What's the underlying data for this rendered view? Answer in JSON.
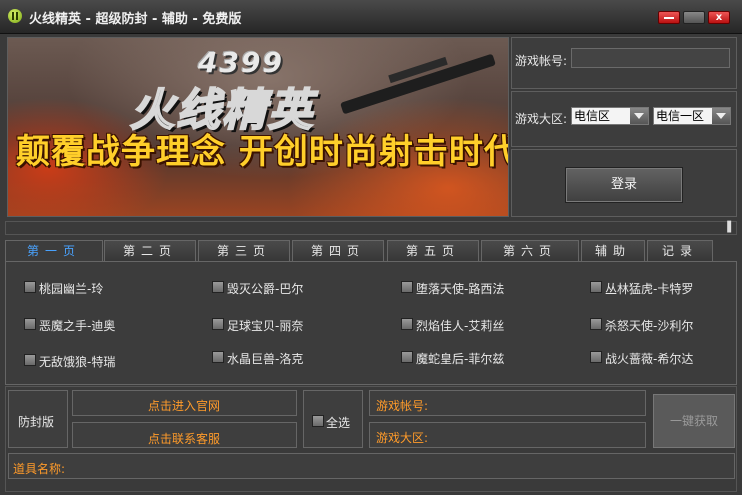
{
  "window": {
    "title": "火线精英 - 超级防封 - 辅助 - 免费版",
    "close_label": "x"
  },
  "banner": {
    "number": "4399",
    "logo": "火线精英",
    "slogan": "颠覆战争理念 开创时尚射击时代"
  },
  "login": {
    "account_label": "游戏帐号:",
    "account_value": "",
    "region_label": "游戏大区:",
    "region_select": "电信区",
    "server_select": "电信一区",
    "login_button": "登录"
  },
  "collapse_icon_glyph": "▐",
  "tabs": [
    {
      "label": "第一页",
      "active": true
    },
    {
      "label": "第二页",
      "active": false
    },
    {
      "label": "第三页",
      "active": false
    },
    {
      "label": "第四页",
      "active": false
    },
    {
      "label": "第五页",
      "active": false
    },
    {
      "label": "第六页",
      "active": false
    },
    {
      "label": "辅助",
      "active": false
    },
    {
      "label": "记录",
      "active": false
    }
  ],
  "items": [
    "桃园幽兰-玲",
    "毁灭公爵-巴尔",
    "堕落天使-路西法",
    "丛林猛虎-卡特罗",
    "恶魔之手-迪奥",
    "足球宝贝-丽奈",
    "烈焰佳人-艾莉丝",
    "杀怒天使-沙利尔",
    "无敌饿狼-特瑞",
    "水晶巨兽-洛克",
    "魔蛇皇后-菲尔兹",
    "战火蔷薇-希尔达"
  ],
  "bottom": {
    "anti_ban": "防封版",
    "official_site": "点击进入官网",
    "contact_service": "点击联系客服",
    "select_all": "全选",
    "account_label": "游戏帐号:",
    "region_label": "游戏大区:",
    "get_button": "一键获取",
    "item_name_label": "道具名称:"
  },
  "colors": {
    "accent_tab": "#4aa3ff",
    "link_orange": "#ff9b2a",
    "slogan_yellow": "#ffcf2a"
  }
}
